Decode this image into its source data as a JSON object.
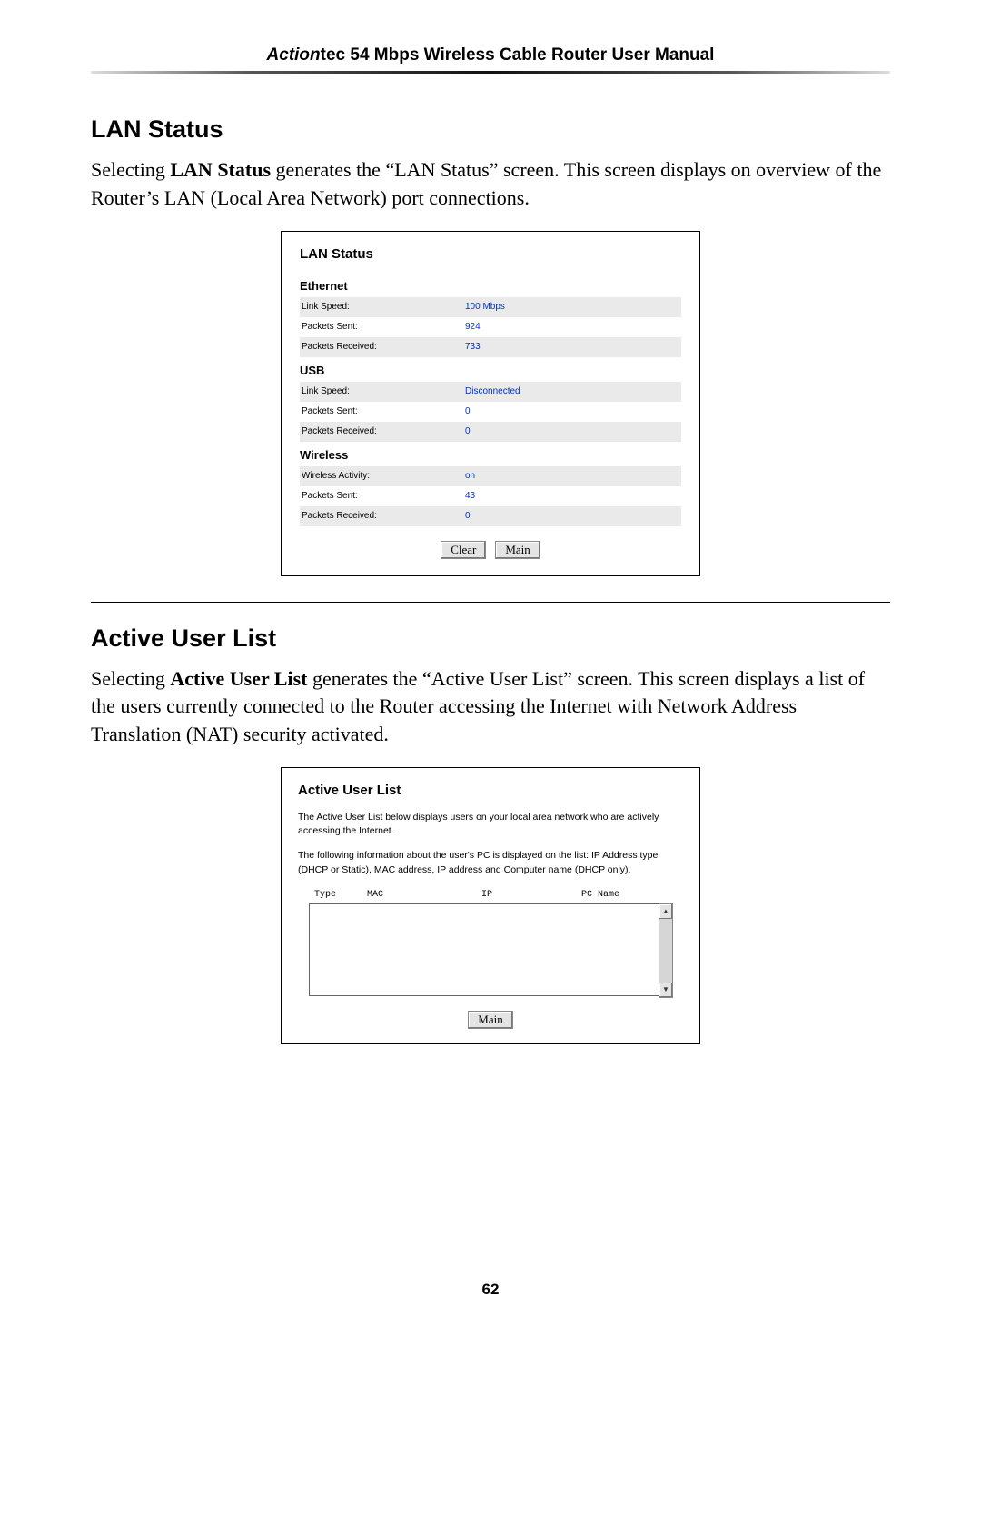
{
  "header": {
    "brand_italic": "Action",
    "brand_rest": "tec 54 Mbps Wireless Cable Router User Manual"
  },
  "lan_section": {
    "heading": "LAN Status",
    "para_pre": "Selecting ",
    "para_bold": "LAN Status",
    "para_mid1": " generates the “",
    "para_sc1": "LAN",
    "para_mid2": " Status” screen. This screen displays on overview of the Router’s ",
    "para_sc2": "LAN",
    "para_post": " (Local Area Network) port connections."
  },
  "lan_panel": {
    "title": "LAN Status",
    "groups": [
      {
        "name": "Ethernet",
        "rows": [
          {
            "label": "Link Speed:",
            "value": "100 Mbps"
          },
          {
            "label": "Packets Sent:",
            "value": "924"
          },
          {
            "label": "Packets Received:",
            "value": "733"
          }
        ]
      },
      {
        "name": "USB",
        "rows": [
          {
            "label": "Link Speed:",
            "value": "Disconnected"
          },
          {
            "label": "Packets Sent:",
            "value": "0"
          },
          {
            "label": "Packets Received:",
            "value": "0"
          }
        ]
      },
      {
        "name": "Wireless",
        "rows": [
          {
            "label": "Wireless Activity:",
            "value": "on"
          },
          {
            "label": "Packets Sent:",
            "value": "43"
          },
          {
            "label": "Packets Received:",
            "value": "0"
          }
        ]
      }
    ],
    "buttons": {
      "clear": "Clear",
      "main": "Main"
    }
  },
  "aul_section": {
    "heading": "Active User List",
    "para_pre": "Selecting ",
    "para_bold": "Active User List",
    "para_mid": " generates the “Active User List” screen. This screen displays a list of the users currently connected to the Router accessing the Internet with Network Address Translation (",
    "para_sc": "NAT",
    "para_post": ") security activated."
  },
  "aul_panel": {
    "title": "Active User List",
    "desc1": "The Active User List below displays users on your local area network who are actively accessing the Internet.",
    "desc2": "The following information about the user's PC is displayed on the list: IP Address type (DHCP or Static), MAC address, IP address and Computer name (DHCP only).",
    "columns": {
      "type": "Type",
      "mac": "MAC",
      "ip": "IP",
      "pc": "PC Name"
    },
    "buttons": {
      "main": "Main"
    }
  },
  "page_number": "62"
}
